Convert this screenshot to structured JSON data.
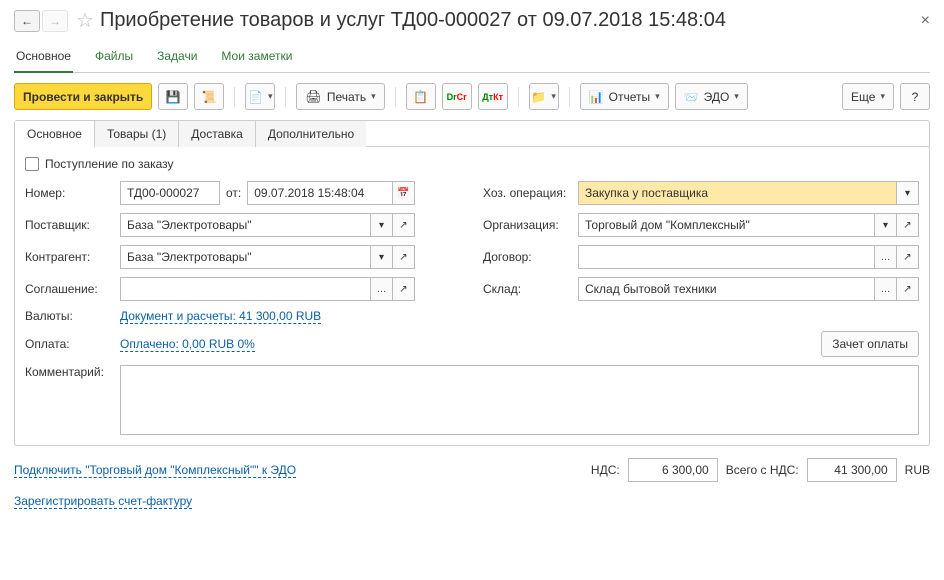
{
  "header": {
    "title": "Приобретение товаров и услуг ТД00-000027 от 09.07.2018 15:48:04"
  },
  "nav": {
    "main": "Основное",
    "files": "Файлы",
    "tasks": "Задачи",
    "notes": "Мои заметки"
  },
  "toolbar": {
    "post_close": "Провести и закрыть",
    "print": "Печать",
    "reports": "Отчеты",
    "edo": "ЭДО",
    "more": "Еще"
  },
  "tabs": {
    "main": "Основное",
    "goods": "Товары (1)",
    "delivery": "Доставка",
    "extra": "Дополнительно"
  },
  "checkbox": {
    "order": "Поступление по заказу"
  },
  "fields": {
    "number_label": "Номер:",
    "number": "ТД00-000027",
    "from": "от:",
    "date": "09.07.2018 15:48:04",
    "supplier_label": "Поставщик:",
    "supplier": "База \"Электротовары\"",
    "contragent_label": "Контрагент:",
    "contragent": "База \"Электротовары\"",
    "agreement_label": "Соглашение:",
    "agreement": "",
    "currency_label": "Валюты:",
    "currency_link": "Документ и расчеты: 41 300,00 RUB",
    "payment_label": "Оплата:",
    "payment_link": "Оплачено: 0,00 RUB  0%",
    "comment_label": "Комментарий:",
    "operation_label": "Хоз. операция:",
    "operation": "Закупка у поставщика",
    "org_label": "Организация:",
    "org": "Торговый дом \"Комплексный\"",
    "contract_label": "Договор:",
    "contract": "",
    "warehouse_label": "Склад:",
    "warehouse": "Склад бытовой техники",
    "zachet": "Зачет оплаты"
  },
  "footer": {
    "edo_link": "Подключить \"Торговый дом \"Комплексный\"\" к ЭДО",
    "invoice_link": "Зарегистрировать счет-фактуру",
    "nds_label": "НДС:",
    "nds": "6 300,00",
    "total_label": "Всего с НДС:",
    "total": "41 300,00",
    "cur": "RUB"
  }
}
